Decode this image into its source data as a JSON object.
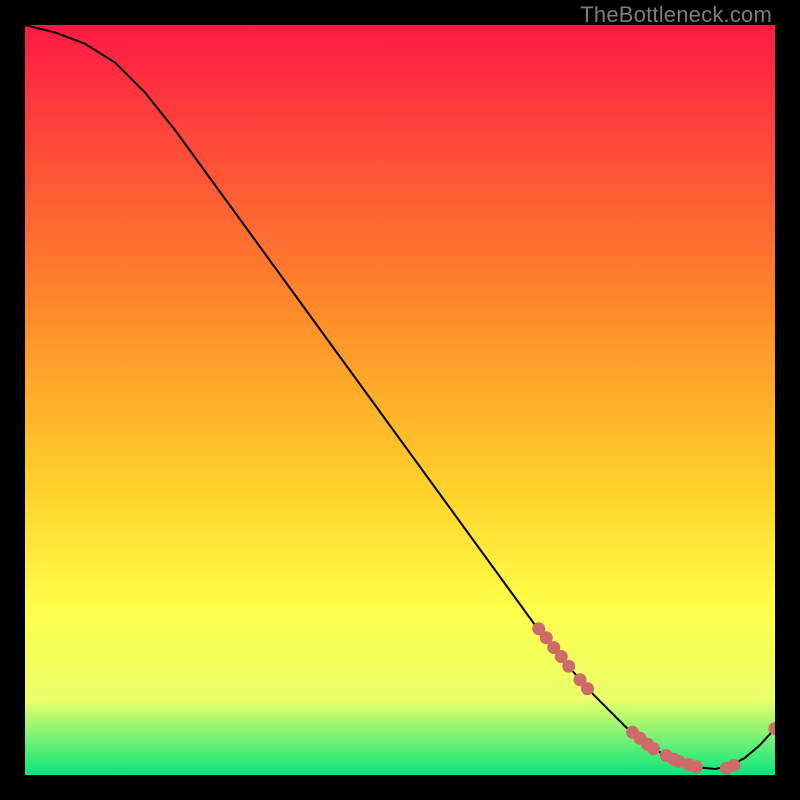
{
  "watermark": "TheBottleneck.com",
  "colors": {
    "curve": "#000000",
    "markers": "#cf6a6a",
    "gradient_top": "#ff1a44",
    "gradient_mid1": "#ff8a2a",
    "gradient_mid2": "#ffd22a",
    "gradient_mid3": "#ffff4a",
    "gradient_mid4": "#e8ff6a",
    "gradient_bottom": "#09e57e"
  },
  "chart_data": {
    "type": "line",
    "title": "",
    "xlabel": "",
    "ylabel": "",
    "xlim": [
      0,
      100
    ],
    "ylim": [
      0,
      100
    ],
    "series": [
      {
        "name": "curve",
        "x": [
          0,
          4,
          8,
          12,
          16,
          20,
          24,
          28,
          32,
          36,
          40,
          44,
          48,
          52,
          56,
          60,
          64,
          68,
          72,
          76,
          80,
          82,
          84,
          86,
          88,
          90,
          92,
          94,
          96,
          98,
          100
        ],
        "y": [
          100,
          99,
          97.5,
          95,
          91,
          86,
          80.5,
          75,
          69.5,
          64,
          58.5,
          53,
          47.5,
          42,
          36.5,
          31,
          25.5,
          20,
          15,
          10.5,
          6.5,
          4.8,
          3.4,
          2.3,
          1.5,
          1.0,
          0.8,
          1.2,
          2.3,
          4.0,
          6.2
        ]
      }
    ],
    "markers": [
      {
        "x": 68.5,
        "y": 19.5
      },
      {
        "x": 69.5,
        "y": 18.3
      },
      {
        "x": 70.5,
        "y": 17.0
      },
      {
        "x": 71.5,
        "y": 15.8
      },
      {
        "x": 72.5,
        "y": 14.5
      },
      {
        "x": 74.0,
        "y": 12.7
      },
      {
        "x": 75.0,
        "y": 11.5
      },
      {
        "x": 81.0,
        "y": 5.7
      },
      {
        "x": 82.0,
        "y": 4.9
      },
      {
        "x": 83.0,
        "y": 4.1
      },
      {
        "x": 83.8,
        "y": 3.5
      },
      {
        "x": 85.5,
        "y": 2.6
      },
      {
        "x": 86.5,
        "y": 2.1
      },
      {
        "x": 87.2,
        "y": 1.8
      },
      {
        "x": 88.5,
        "y": 1.4
      },
      {
        "x": 89.5,
        "y": 1.1
      },
      {
        "x": 93.5,
        "y": 0.9
      },
      {
        "x": 94.5,
        "y": 1.3
      },
      {
        "x": 100.0,
        "y": 6.2
      }
    ]
  }
}
